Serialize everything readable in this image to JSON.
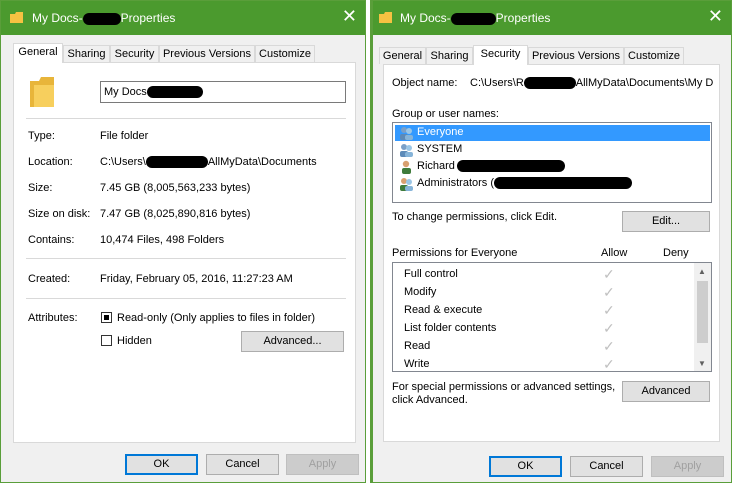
{
  "window1": {
    "title_prefix": "My Docs-",
    "title_suffix": "Properties",
    "close": "✕",
    "tabs": [
      {
        "label": "General",
        "active": true
      },
      {
        "label": "Sharing"
      },
      {
        "label": "Security"
      },
      {
        "label": "Previous Versions"
      },
      {
        "label": "Customize"
      }
    ],
    "name_value": "My Docs",
    "rows": [
      {
        "label": "Type:",
        "value": "File folder"
      },
      {
        "label": "Location:",
        "value_prefix": "C:\\Users\\",
        "value_suffix": "AllMyData\\Documents"
      },
      {
        "label": "Size:",
        "value": "7.45 GB (8,005,563,233 bytes)"
      },
      {
        "label": "Size on disk:",
        "value": "7.47 GB (8,025,890,816 bytes)"
      },
      {
        "label": "Contains:",
        "value": "10,474 Files, 498 Folders"
      },
      {
        "label": "Created:",
        "value": "Friday, February 05, 2016, 11:27:23 AM"
      }
    ],
    "attributes_label": "Attributes:",
    "readonly_label": "Read-only (Only applies to files in folder)",
    "hidden_label": "Hidden",
    "advanced_label": "Advanced...",
    "ok": "OK",
    "cancel": "Cancel",
    "apply": "Apply"
  },
  "window2": {
    "title_prefix": "My Docs-",
    "title_suffix": "Properties",
    "close": "✕",
    "tabs": [
      {
        "label": "General"
      },
      {
        "label": "Sharing"
      },
      {
        "label": "Security",
        "active": true
      },
      {
        "label": "Previous Versions"
      },
      {
        "label": "Customize"
      }
    ],
    "object_name_label": "Object name:",
    "object_name_prefix": "C:\\Users\\R",
    "object_name_suffix": "AllMyData\\Documents\\My D",
    "group_label": "Group or user names:",
    "users": [
      {
        "name": "Everyone",
        "selected": true
      },
      {
        "name": "SYSTEM"
      },
      {
        "name": "Richard"
      },
      {
        "name": "Administrators ("
      }
    ],
    "change_perm_text": "To change permissions, click Edit.",
    "edit_label": "Edit...",
    "perm_for_label": "Permissions for Everyone",
    "allow_label": "Allow",
    "deny_label": "Deny",
    "permissions": [
      {
        "name": "Full control",
        "allow": true
      },
      {
        "name": "Modify",
        "allow": true
      },
      {
        "name": "Read & execute",
        "allow": true
      },
      {
        "name": "List folder contents",
        "allow": true
      },
      {
        "name": "Read",
        "allow": true
      },
      {
        "name": "Write",
        "allow": true
      }
    ],
    "check_glyph": "✓",
    "special_text_1": "For special permissions or advanced settings,",
    "special_text_2": "click Advanced.",
    "advanced_label": "Advanced",
    "ok": "OK",
    "cancel": "Cancel",
    "apply": "Apply"
  },
  "colors": {
    "titlebar": "#4b9a2e",
    "selection": "#3399ff",
    "focus_border": "#0078d7"
  }
}
